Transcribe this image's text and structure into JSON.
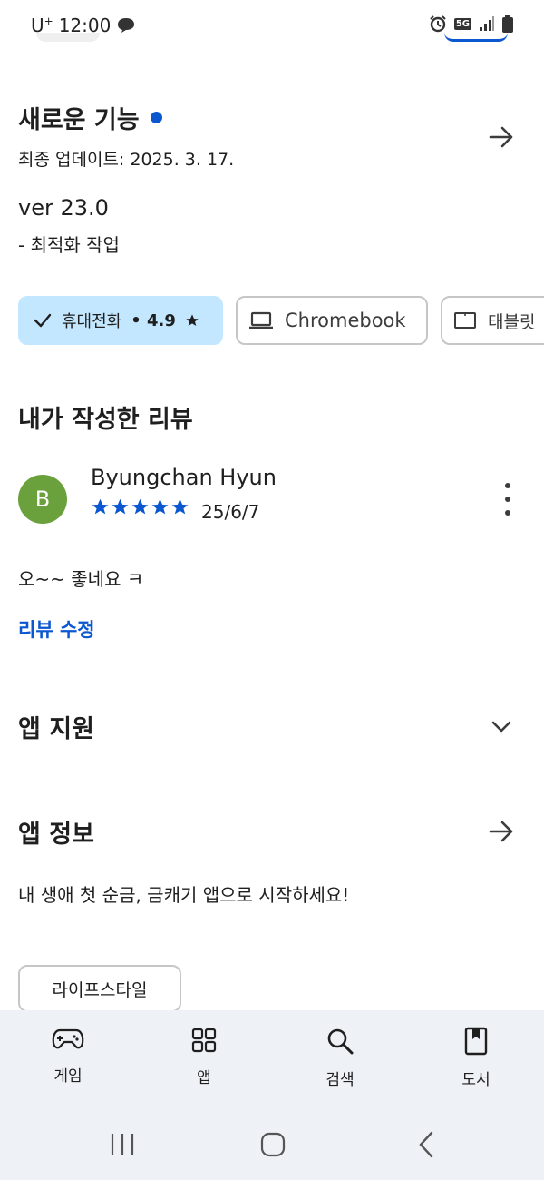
{
  "status_bar": {
    "carrier": "U",
    "carrier_sup": "+",
    "time": "12:00",
    "network": "5G"
  },
  "whats_new": {
    "title": "새로운 기능",
    "updated": "최종 업데이트: 2025. 3. 17.",
    "version": "ver 23.0",
    "changes": "- 최적화 작업"
  },
  "device_chips": {
    "phone": {
      "label": "휴대전화",
      "rating": "• 4.9",
      "icon": "check-icon"
    },
    "chromebook": {
      "label": "Chromebook",
      "icon": "laptop-icon"
    },
    "tablet": {
      "label": "태블릿",
      "icon": "tablet-icon"
    }
  },
  "my_review": {
    "heading": "내가 작성한 리뷰",
    "avatar_letter": "B",
    "reviewer": "Byungchan Hyun",
    "stars": 5,
    "date": "25/6/7",
    "text": "오~~ 좋네요 ㅋ",
    "edit_label": "리뷰 수정"
  },
  "app_support": {
    "title": "앱 지원"
  },
  "app_info": {
    "title": "앱 정보",
    "description": "내 생애 첫 순금, 금캐기 앱으로 시작하세요!",
    "category": "라이프스타일"
  },
  "bottom_nav": {
    "games": "게임",
    "apps": "앱",
    "search": "검색",
    "books": "도서"
  },
  "colors": {
    "accent": "#0b57d0",
    "chip_selected": "#c2e7ff",
    "avatar": "#6aa13d",
    "nav_bg": "#eef1f6"
  }
}
